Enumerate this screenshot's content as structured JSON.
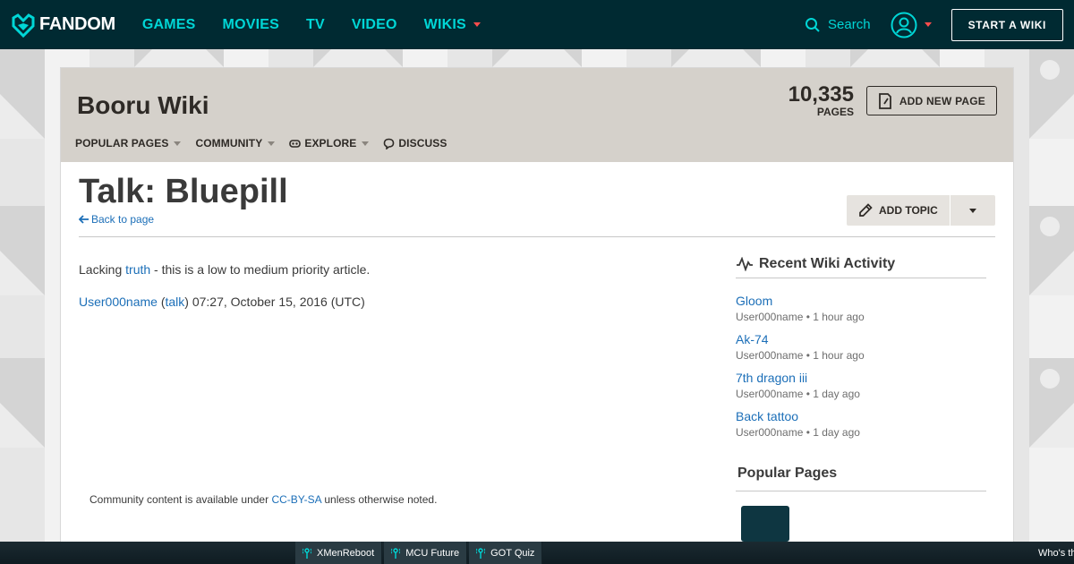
{
  "global_nav": {
    "logo": "FANDOM",
    "links": [
      {
        "label": "GAMES"
      },
      {
        "label": "MOVIES"
      },
      {
        "label": "TV"
      },
      {
        "label": "VIDEO"
      },
      {
        "label": "WIKIS",
        "has_dropdown": true
      }
    ],
    "search_label": "Search",
    "start_wiki": "START A WIKI",
    "accent_color": "#00d6d6",
    "bg_color": "#002a32"
  },
  "wiki": {
    "name": "Booru Wiki",
    "page_count": "10,335",
    "page_count_label": "PAGES",
    "add_new_page": "ADD NEW PAGE",
    "nav": [
      {
        "label": "POPULAR PAGES",
        "icon": "",
        "has_dropdown": true
      },
      {
        "label": "COMMUNITY",
        "icon": "",
        "has_dropdown": true
      },
      {
        "label": "EXPLORE",
        "icon": "explore-icon",
        "has_dropdown": true
      },
      {
        "label": "DISCUSS",
        "icon": "discuss-icon",
        "has_dropdown": false
      }
    ]
  },
  "page": {
    "title": "Talk: Bluepill",
    "back_link": "Back to page",
    "add_topic": "ADD TOPIC"
  },
  "article": {
    "line1_prefix": "Lacking ",
    "line1_link": "truth",
    "line1_suffix": " - this is a low to medium priority article.",
    "sig_user": "User000name",
    "sig_open": " (",
    "sig_talk": "talk",
    "sig_close": ") 07:27, October 15, 2016 (UTC)"
  },
  "license": {
    "prefix": "Community content is available under ",
    "link": "CC-BY-SA",
    "suffix": " unless otherwise noted."
  },
  "rail": {
    "recent_title": "Recent Wiki Activity",
    "activity": [
      {
        "title": "Gloom",
        "meta": "User000name • 1 hour ago"
      },
      {
        "title": "Ak-74",
        "meta": "User000name • 1 hour ago"
      },
      {
        "title": "7th dragon iii",
        "meta": "User000name • 1 day ago"
      },
      {
        "title": "Back tattoo",
        "meta": "User000name • 1 day ago"
      }
    ],
    "popular_title": "Popular Pages"
  },
  "bottom_bar": {
    "items": [
      {
        "label": "XMenReboot"
      },
      {
        "label": "MCU Future"
      },
      {
        "label": "GOT Quiz"
      }
    ],
    "right_text": "Who's th"
  }
}
